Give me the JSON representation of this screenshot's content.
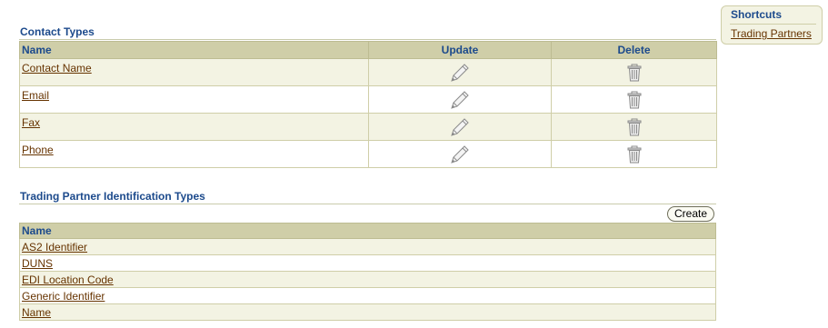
{
  "contact_types": {
    "title": "Contact Types",
    "headers": {
      "name": "Name",
      "update": "Update",
      "delete": "Delete"
    },
    "rows": [
      {
        "name": "Contact Name"
      },
      {
        "name": "Email"
      },
      {
        "name": "Fax"
      },
      {
        "name": "Phone"
      }
    ],
    "icons": {
      "update": "pencil-icon",
      "delete": "trash-can-icon"
    }
  },
  "trading_partner_id_types": {
    "title": "Trading Partner Identification Types",
    "create_label": "Create",
    "header_name": "Name",
    "rows": [
      {
        "name": "AS2 Identifier"
      },
      {
        "name": "DUNS"
      },
      {
        "name": "EDI Location Code"
      },
      {
        "name": "Generic Identifier"
      },
      {
        "name": "Name"
      }
    ]
  },
  "shortcuts": {
    "title": "Shortcuts",
    "links": [
      {
        "label": "Trading Partners"
      }
    ]
  },
  "colors": {
    "header_text": "#1c4a8c",
    "link_text": "#663300",
    "header_bg": "#cfcea8",
    "band_bg": "#f3f3e3"
  }
}
